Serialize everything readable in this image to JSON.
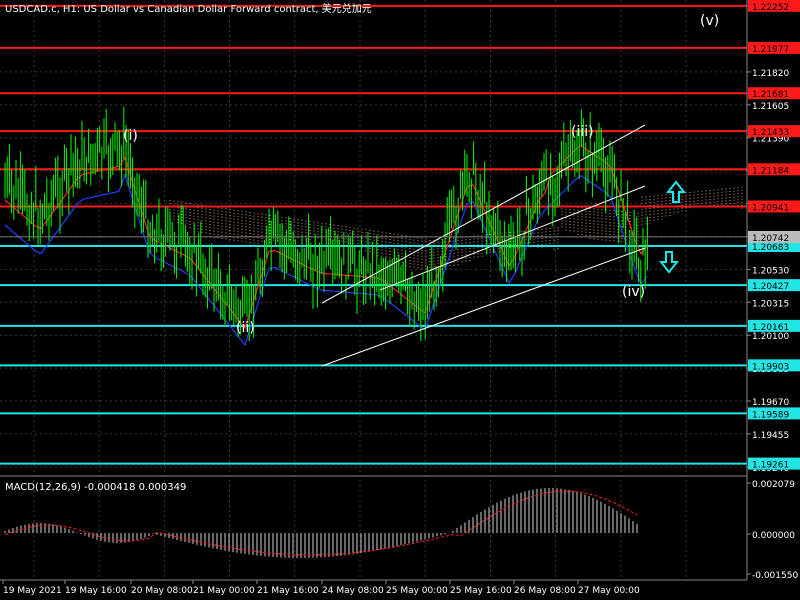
{
  "window": {
    "title": "USDCAD.c, H1:  US Dollar vs Canadian Dollar Forward contract, 美元兑加元"
  },
  "colors": {
    "background": "#000000",
    "grid": "#3a3a3a",
    "price_green": "#00ff00",
    "resistance": "#ff1a1a",
    "support": "#22e6e6",
    "ichimoku_cloud": "#d8a080",
    "ma_red": "#ff2020",
    "ma_blue": "#2040ff",
    "axis_text": "#ffffff"
  },
  "wave_labels": {
    "w1": "(i)",
    "w2": "(ii)",
    "w3": "(iii)",
    "w4": "(iv)",
    "w5": "(v)"
  },
  "price_axis": {
    "ticks": [
      "1.21820",
      "1.21605",
      "1.21390",
      "1.21175",
      "1.20960",
      "1.20745",
      "1.20530",
      "1.20315",
      "1.20100",
      "1.19885",
      "1.19670",
      "1.19455",
      "1.19240"
    ]
  },
  "levels": {
    "resistance": [
      "1.22252",
      "1.21977",
      "1.21681",
      "1.21433",
      "1.21184",
      "1.20941"
    ],
    "current_price": "1.20742",
    "support": [
      "1.20683",
      "1.20427",
      "1.20161",
      "1.19903",
      "1.19589",
      "1.19261"
    ]
  },
  "arrows": {
    "up": "up-arrow-icon",
    "down": "down-arrow-icon"
  },
  "macd": {
    "label": "MACD(12,26,9) -0.000418 0.000349",
    "ticks": [
      "0.002079",
      "0.000000",
      "-0.001550"
    ]
  },
  "time_axis": {
    "ticks": [
      "19 May 2021",
      "19 May 16:00",
      "20 May 08:00",
      "21 May 00:00",
      "21 May 16:00",
      "24 May 08:00",
      "25 May 00:00",
      "25 May 16:00",
      "26 May 08:00",
      "27 May 00:00"
    ]
  }
}
